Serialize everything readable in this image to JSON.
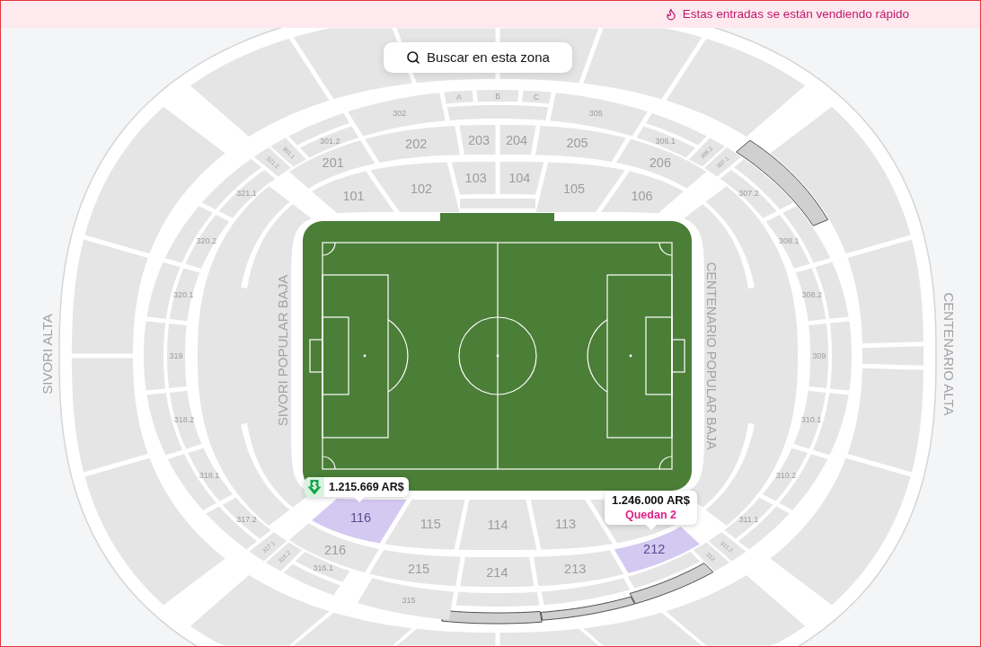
{
  "banner": {
    "text": "Estas entradas se están vendiendo rápido"
  },
  "search_button": {
    "label": "Buscar en esta zona"
  },
  "stand_labels": [
    "SIVORI ALTA",
    "SIVORI POPULAR BAJA",
    "CENTENARIO POPULAR BAJA",
    "CENTENARIO ALTA"
  ],
  "lower_sections": [
    {
      "label": "101",
      "available": false
    },
    {
      "label": "102",
      "available": false
    },
    {
      "label": "103",
      "available": false
    },
    {
      "label": "104",
      "available": false
    },
    {
      "label": "105",
      "available": false
    },
    {
      "label": "106",
      "available": false
    },
    {
      "label": "116",
      "available": true
    },
    {
      "label": "115",
      "available": false
    },
    {
      "label": "114",
      "available": false
    },
    {
      "label": "113",
      "available": false
    }
  ],
  "middle_sections": [
    {
      "label": "201",
      "available": false
    },
    {
      "label": "202",
      "available": false
    },
    {
      "label": "203",
      "available": false
    },
    {
      "label": "204",
      "available": false
    },
    {
      "label": "205",
      "available": false
    },
    {
      "label": "206",
      "available": false
    },
    {
      "label": "216",
      "available": false
    },
    {
      "label": "215",
      "available": false
    },
    {
      "label": "214",
      "available": false
    },
    {
      "label": "213",
      "available": false
    },
    {
      "label": "212",
      "available": true
    }
  ],
  "upper_sections": [
    {
      "label": "315",
      "available": false
    },
    {
      "label": "316.1",
      "available": false
    },
    {
      "label": "316.2",
      "available": false
    },
    {
      "label": "317.1",
      "available": false
    },
    {
      "label": "317.2",
      "available": false
    },
    {
      "label": "318.1",
      "available": false
    },
    {
      "label": "318.2",
      "available": false
    },
    {
      "label": "319",
      "available": false
    },
    {
      "label": "320.1",
      "available": false
    },
    {
      "label": "320.2",
      "available": false
    },
    {
      "label": "321.1",
      "available": false
    },
    {
      "label": "321.2",
      "available": false
    },
    {
      "label": "301.1",
      "available": false
    },
    {
      "label": "301.2",
      "available": false
    },
    {
      "label": "302",
      "available": false
    },
    {
      "label": "A",
      "available": false
    },
    {
      "label": "B",
      "available": false
    },
    {
      "label": "C",
      "available": false
    },
    {
      "label": "305",
      "available": false
    },
    {
      "label": "306.1",
      "available": false
    },
    {
      "label": "306.2",
      "available": false
    },
    {
      "label": "307.1",
      "available": false
    },
    {
      "label": "307.2",
      "available": false
    },
    {
      "label": "308.1",
      "available": false
    },
    {
      "label": "308.2",
      "available": false
    },
    {
      "label": "309",
      "available": false
    },
    {
      "label": "310.1",
      "available": false
    },
    {
      "label": "310.2",
      "available": false
    },
    {
      "label": "311.1",
      "available": false
    },
    {
      "label": "311.2",
      "available": false
    },
    {
      "label": "312",
      "available": false
    }
  ],
  "price_tags": [
    {
      "kind": "deal",
      "price": "1.215.669 AR$"
    },
    {
      "kind": "plain",
      "price": "1.246.000 AR$",
      "note": "Quedan 2"
    }
  ]
}
